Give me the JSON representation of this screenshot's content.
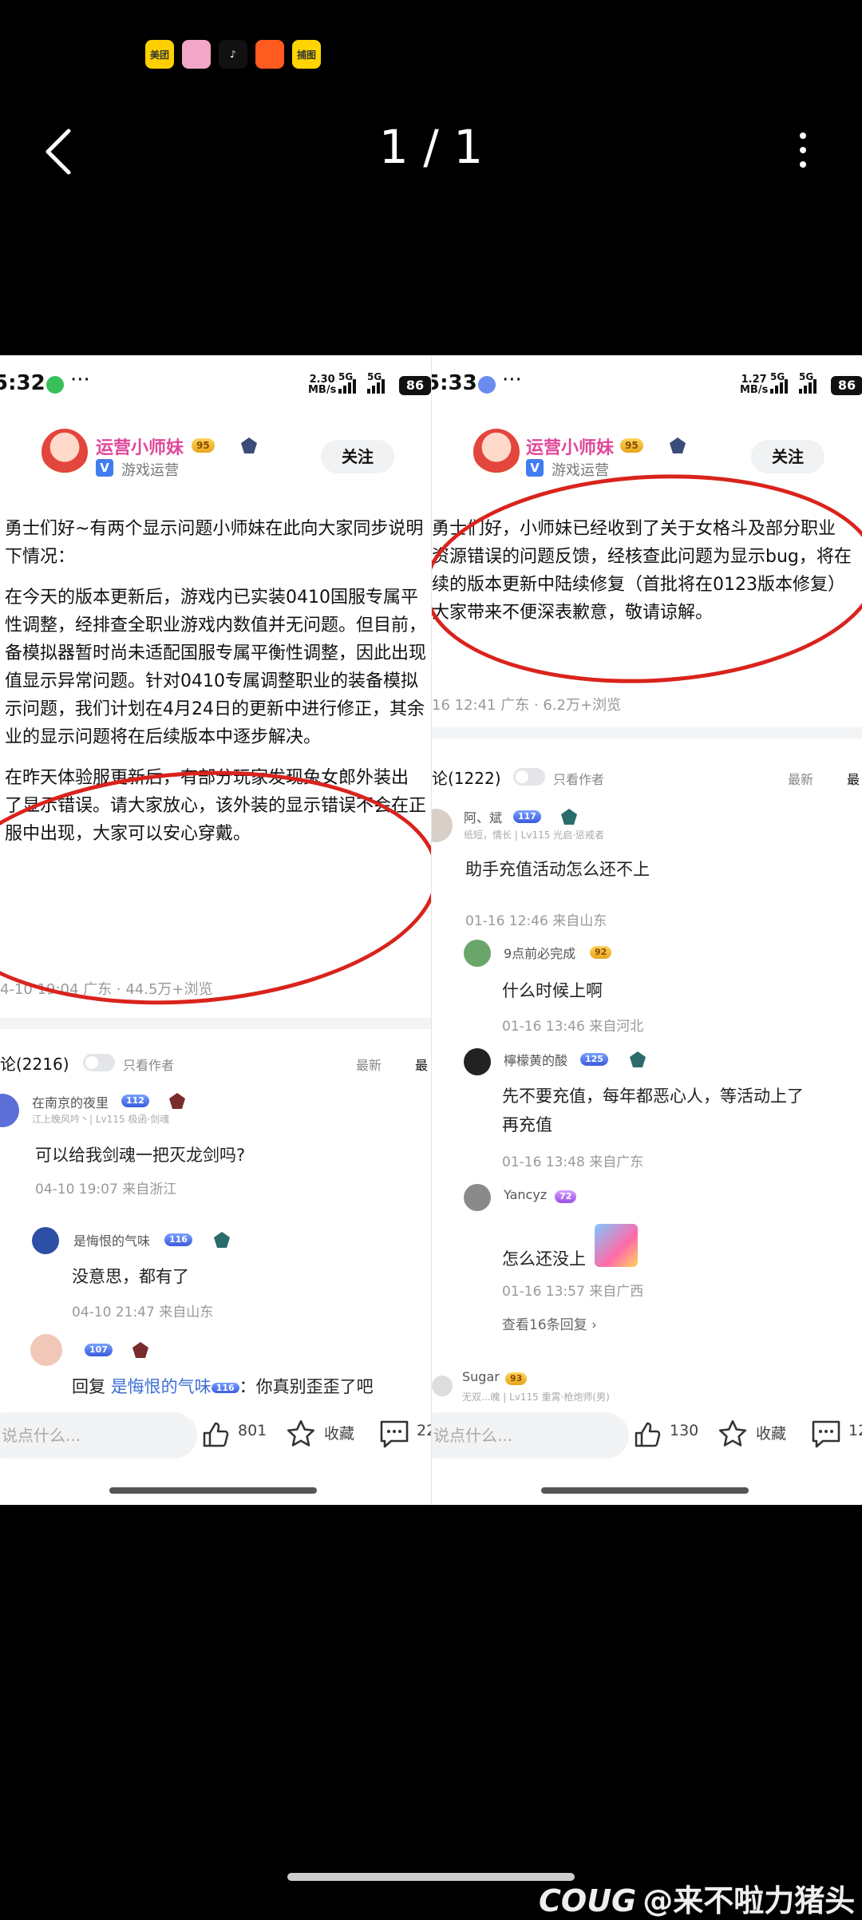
{
  "viewer": {
    "app_icons": [
      {
        "name": "meituan-app-icon",
        "label": "美团",
        "color": "#ffd000",
        "text_color": "#333"
      },
      {
        "name": "pink-app-icon",
        "label": "",
        "color": "#f3a6c8"
      },
      {
        "name": "douyin-app-icon",
        "label": "♪",
        "color": "#111111"
      },
      {
        "name": "kuaishou-app-icon",
        "label": "",
        "color": "#ff5a1f"
      },
      {
        "name": "hungry-app-icon",
        "label": "捕图",
        "color": "#ffd400",
        "text_color": "#333"
      }
    ],
    "counter": "1 / 1",
    "watermark": "@来不啦力猪头",
    "watermark_logo": "COUG"
  },
  "left": {
    "status": {
      "time": "5:32",
      "net": "2.30\nMB/s",
      "battery": "86"
    },
    "author": {
      "name": "运营小师妹",
      "level": "95",
      "role": "游戏运营",
      "follow": "关注"
    },
    "post_lines": [
      "勇士们好~有两个显示问题小师妹在此向大家同步说明",
      "下情况：",
      "",
      "在今天的版本更新后，游戏内已实装0410国服专属平",
      "性调整，经排查全职业游戏内数值并无问题。但目前，",
      "备模拟器暂时尚未适配国服专属平衡性调整，因此出现",
      "值显示异常问题。针对0410专属调整职业的装备模拟",
      "示问题，我们计划在4月24日的更新中进行修正，其余",
      "业的显示问题将在后续版本中逐步解决。",
      "",
      "在昨天体验服更新后，有部分玩家发现兔女郎外装出",
      "了显示错误。请大家放心，该外装的显示错误不会在正",
      "服中出现，大家可以安心穿戴。"
    ],
    "post_meta": "4-10 19:04 广东 · 44.5万+浏览",
    "comments_title": "论(2216)",
    "only_author": "只看作者",
    "sort_new": "最新",
    "sort_hot": "最",
    "comments": [
      {
        "name": "在南京的夜里",
        "level": "112",
        "sub": "江上晚风吟丶| Lv115 极函·剑魂",
        "text": "可以给我剑魂一把灭龙剑吗?",
        "meta": "04-10 19:07  来自浙江"
      },
      {
        "name": "是悔恨的气味",
        "level": "116",
        "text": "没意思，都有了",
        "meta": "04-10 21:47  来自山东"
      },
      {
        "name": "",
        "level": "107",
        "reply_prefix": "回复 ",
        "reply_to": "是悔恨的气味",
        "reply_level": "116",
        "reply_text": "：你真别歪歪了吧"
      }
    ],
    "input_placeholder": "说点什么...",
    "likes": "801",
    "collect": "收藏",
    "comments_count": "22"
  },
  "right": {
    "status": {
      "time": "5:33",
      "net": "1.27\nMB/s",
      "battery": "86"
    },
    "author": {
      "name": "运营小师妹",
      "level": "95",
      "role": "游戏运营",
      "follow": "关注"
    },
    "post_lines": [
      "勇士们好，小师妹已经收到了关于女格斗及部分职业",
      "资源错误的问题反馈，经核查此问题为显示bug，将在",
      "续的版本更新中陆续修复（首批将在0123版本修复）",
      "大家带来不便深表歉意，敬请谅解。"
    ],
    "post_meta": "16 12:41 广东 · 6.2万+浏览",
    "comments_title": "论(1222)",
    "only_author": "只看作者",
    "sort_new": "最新",
    "sort_hot": "最",
    "comments": [
      {
        "name": "阿、斌",
        "level": "117",
        "sub": "纸短，情长 | Lv115 光启·惩戒者",
        "text": "助手充值活动怎么还不上",
        "meta": "01-16 12:46  来自山东"
      },
      {
        "name": "9点前必完成",
        "level": "92",
        "text": "什么时候上啊",
        "meta": "01-16 13:46  来自河北"
      },
      {
        "name": "檸檬黄的酸",
        "level": "125",
        "text": "先不要充值，每年都恶心人，等活动上了",
        "text2": "再充值",
        "meta": "01-16 13:48  来自广东"
      },
      {
        "name": "Yancyz",
        "level": "72",
        "text": "怎么还没上",
        "meta": "01-16 13:57  来自广西"
      },
      {
        "name": "Sugar",
        "level": "93",
        "sub": "无双...魄 | Lv115 重霄·枪炮师(男)"
      }
    ],
    "more_replies": "查看16条回复",
    "input_placeholder": "说点什么...",
    "likes": "130",
    "collect": "收藏",
    "comments_count": "12"
  }
}
